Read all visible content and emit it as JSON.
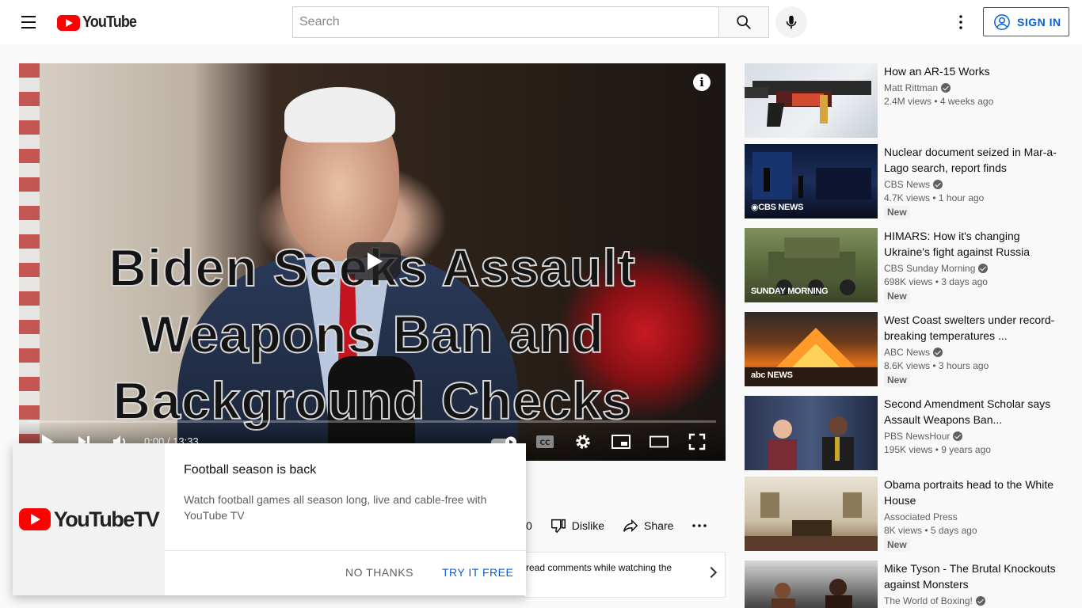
{
  "header": {
    "logo_text": "YouTube",
    "search_placeholder": "Search",
    "signin_label": "SIGN IN"
  },
  "player": {
    "overlay_title_lines": [
      "Biden Seeks Assault",
      "Weapons Ban and",
      "Background Checks"
    ],
    "time_display": "0:00 / 13:33",
    "info_glyph": "i"
  },
  "actions": {
    "like_count": "0",
    "dislike_label": "Dislike",
    "share_label": "Share"
  },
  "comments_strip": {
    "text": "read comments while watching the"
  },
  "promo": {
    "brand_text": "YouTubeTV",
    "title": "Football season is back",
    "body": "Watch football games all season long, live and cable-free with YouTube TV",
    "no_label": "NO THANKS",
    "try_label": "TRY IT FREE"
  },
  "recommendations": [
    {
      "title": "How an AR-15 Works",
      "channel": "Matt Rittman",
      "views": "2.4M views • 4 weeks ago",
      "new": "",
      "brand": ""
    },
    {
      "title": "Nuclear document seized in Mar-a-Lago search, report finds",
      "channel": "CBS News",
      "views": "4.7K views • 1 hour ago",
      "new": "New",
      "brand": "◉CBS NEWS"
    },
    {
      "title": "HIMARS: How it's changing Ukraine's fight against Russia",
      "channel": "CBS Sunday Morning",
      "views": "698K views • 3 days ago",
      "new": "New",
      "brand": "SUNDAY MORNING"
    },
    {
      "title": "West Coast swelters under record-breaking temperatures ...",
      "channel": "ABC News",
      "views": "8.6K views • 3 hours ago",
      "new": "New",
      "brand": "abc NEWS"
    },
    {
      "title": "Second Amendment Scholar says Assault Weapons Ban...",
      "channel": "PBS NewsHour",
      "views": "195K views • 9 years ago",
      "new": "",
      "brand": ""
    },
    {
      "title": "Obama portraits head to the White House",
      "channel": "Associated Press",
      "views": "8K views • 5 days ago",
      "new": "New",
      "brand": ""
    },
    {
      "title": "Mike Tyson - The Brutal Knockouts against Monsters",
      "channel": "The World of Boxing!",
      "views": "",
      "new": "",
      "brand": ""
    }
  ]
}
